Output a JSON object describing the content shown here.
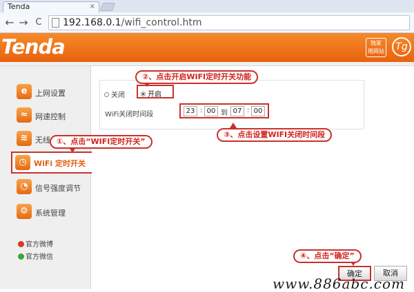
{
  "browser": {
    "tab_title": "Tenda",
    "tab_close": "×",
    "back": "←",
    "forward": "→",
    "reload": "C",
    "url_host": "192.168.0.1",
    "url_path": "/wifi_control.htm"
  },
  "header": {
    "logo": "Tenda",
    "badge_top": "独家",
    "badge_bottom": "用网站",
    "badge_right": "Tg"
  },
  "sidebar": {
    "items": [
      {
        "label": "上网设置",
        "icon": "e"
      },
      {
        "label": "网速控制",
        "icon": "≈"
      },
      {
        "label": "无线",
        "icon": "≋"
      },
      {
        "label": "WiFi 定时开关",
        "icon": "◷"
      },
      {
        "label": "信号强度调节",
        "icon": "◔"
      },
      {
        "label": "系统管理",
        "icon": "⚙"
      }
    ],
    "social": [
      {
        "label": "官方微博",
        "color": "#d9382b"
      },
      {
        "label": "官方微信",
        "color": "#3aa63a"
      }
    ]
  },
  "main": {
    "off_label": "关闭",
    "on_label": "开启",
    "time_label": "WiFi关闭时间段",
    "start_hour": "23",
    "start_minute": "00",
    "to_label": "到",
    "end_hour": "07",
    "end_minute": "00",
    "colon": ":"
  },
  "callouts": {
    "step1": "①、点击“WIFI定时开关”",
    "step2": "②、点击开启WIFI定时开关功能",
    "step3": "③、点击设置WIFI关闭时间段",
    "step4": "④、点击“确定”"
  },
  "buttons": {
    "ok": "确定",
    "cancel": "取消"
  },
  "watermark": "www.886abc.com",
  "colors": {
    "brand_orange": "#ef7a1d",
    "highlight_red": "#c9302c",
    "callout_text": "#d0231e"
  }
}
